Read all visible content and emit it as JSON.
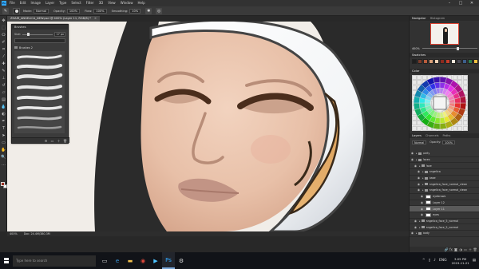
{
  "app": {
    "menu": [
      "File",
      "Edit",
      "Image",
      "Layer",
      "Type",
      "Select",
      "Filter",
      "3D",
      "View",
      "Window",
      "Help"
    ],
    "window_controls": [
      "–",
      "□",
      "✕"
    ]
  },
  "options_bar": {
    "mode_label": "Mode:",
    "mode_value": "Normal",
    "opacity_label": "Opacity:",
    "opacity_value": "100%",
    "flow_label": "Flow:",
    "flow_value": "100%",
    "smoothing_label": "Smoothing:",
    "smoothing_value": "10%"
  },
  "document": {
    "tab_title": "ZHAIR_ANGELICA_NEW.psd @ 400% (Layer 11, RGB/8) *",
    "zoom": "400%",
    "doc_size": "Doc: 24.4M/380.3M"
  },
  "brushes_panel": {
    "title": "Brushes",
    "size_label": "Size:",
    "size_value": "17 px",
    "folder_label": "Brushes 2",
    "stroke_count": 8
  },
  "right_panels": {
    "navigator_tabs": [
      "Navigator",
      "Histogram"
    ],
    "navigator_zoom": "400%",
    "swatches_tabs": [
      "Swatches"
    ],
    "color_tabs": [
      "Color"
    ],
    "layers_tabs": [
      "Layers",
      "Channels",
      "Paths"
    ],
    "blend_mode": "Normal",
    "opacity_label": "Opacity:",
    "opacity_value": "100%",
    "fill_label": "Fill:",
    "fill_value": "100%",
    "swatch_colors": [
      "#1e1e1e",
      "#7b3b2a",
      "#b85c3c",
      "#d9a079",
      "#eed0b4",
      "#8a2a1e",
      "#c43c2a",
      "#f2e6da",
      "#4b4b55",
      "#3c5f8a",
      "#2e7d4e",
      "#f0c040"
    ]
  },
  "layers": [
    {
      "name": "party",
      "type": "folder",
      "depth": 0,
      "visible": true,
      "active": false
    },
    {
      "name": "faces",
      "type": "folder",
      "depth": 0,
      "visible": true,
      "active": false
    },
    {
      "name": "face",
      "type": "folder",
      "depth": 1,
      "visible": true,
      "active": false
    },
    {
      "name": "angelica",
      "type": "folder",
      "depth": 2,
      "visible": true,
      "active": false
    },
    {
      "name": "base",
      "type": "folder",
      "depth": 2,
      "visible": true,
      "active": false
    },
    {
      "name": "angelica_face_normal_clean",
      "type": "folder",
      "depth": 2,
      "visible": true,
      "active": false
    },
    {
      "name": "angelica_face_normal_clean",
      "type": "folder",
      "depth": 2,
      "visible": true,
      "active": false
    },
    {
      "name": "eyebrows",
      "type": "layer",
      "depth": 3,
      "visible": true,
      "active": false
    },
    {
      "name": "Layer 12",
      "type": "layer",
      "depth": 3,
      "visible": true,
      "active": false
    },
    {
      "name": "Layer 11",
      "type": "layer",
      "depth": 3,
      "visible": true,
      "active": true
    },
    {
      "name": "eyes",
      "type": "layer",
      "depth": 3,
      "visible": true,
      "active": false
    },
    {
      "name": "angelica_face_5_normal",
      "type": "folder",
      "depth": 1,
      "visible": true,
      "active": false
    },
    {
      "name": "angelica_face_5_normal",
      "type": "folder",
      "depth": 1,
      "visible": true,
      "active": false
    },
    {
      "name": "body",
      "type": "folder",
      "depth": 0,
      "visible": true,
      "active": false
    }
  ],
  "taskbar": {
    "search_placeholder": "Type here to search",
    "language": "ENG",
    "time": "3:05 PM",
    "date": "2019-11-21"
  }
}
